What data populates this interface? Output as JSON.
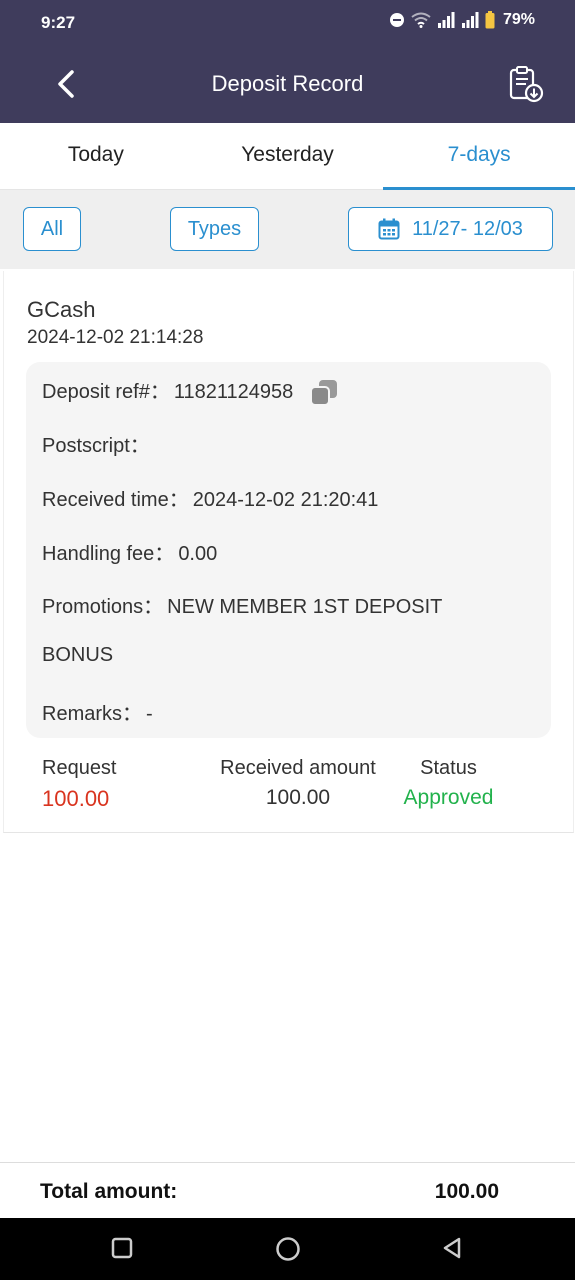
{
  "status_bar": {
    "time": "9:27",
    "battery": "79%",
    "icons": [
      "dnd-icon",
      "wifi-icon",
      "signal-icon",
      "signal-icon",
      "battery-icon"
    ]
  },
  "navbar": {
    "title": "Deposit Record",
    "back_icon": "chevron-left-icon",
    "action_icon": "clipboard-download-icon"
  },
  "tabs": [
    {
      "label": "Today",
      "active": false
    },
    {
      "label": "Yesterday",
      "active": false
    },
    {
      "label": "7-days",
      "active": true
    }
  ],
  "filters": {
    "all_label": "All",
    "types_label": "Types",
    "date_range": "11/27- 12/03",
    "date_icon": "calendar-icon"
  },
  "record": {
    "method": "GCash",
    "datetime": "2024-12-02 21:14:28",
    "deposit_ref_label": "Deposit ref#：",
    "deposit_ref": "11821124958",
    "postscript_label": "Postscript：",
    "postscript": "",
    "received_time_label": "Received time：",
    "received_time": "2024-12-02 21:20:41",
    "handling_fee_label": "Handling fee：",
    "handling_fee": "0.00",
    "promotions_label": "Promotions：",
    "promotions_line1": "NEW MEMBER 1ST DEPOSIT",
    "promotions_line2": "BONUS",
    "remarks_label": "Remarks：",
    "remarks": "-",
    "request_label": "Request",
    "request_value": "100.00",
    "received_amount_label": "Received amount",
    "received_amount_value": "100.00",
    "status_label": "Status",
    "status_value": "Approved"
  },
  "footer": {
    "total_label": "Total amount:",
    "total_value": "100.00"
  },
  "colors": {
    "header_bg": "#3f3c5c",
    "accent": "#2a8fcf",
    "request_red": "#d9341f",
    "approved_green": "#22b24c"
  }
}
